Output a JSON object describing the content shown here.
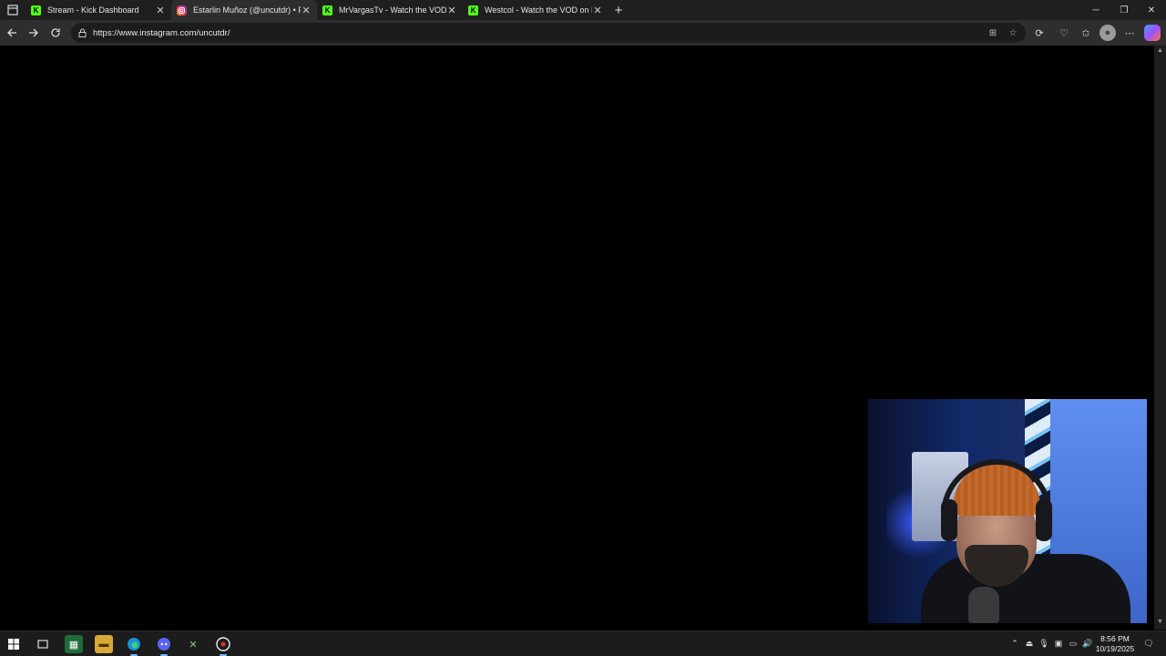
{
  "browser": {
    "tabs": [
      {
        "title": "Stream - Kick Dashboard",
        "favicon": "kick-icon",
        "active": false
      },
      {
        "title": "Estarlin Muñoz (@uncutdr) • Foto",
        "favicon": "instagram-icon",
        "active": true
      },
      {
        "title": "MrVargasTv - Watch the VOD on",
        "favicon": "kick-icon",
        "active": false
      },
      {
        "title": "Westcol - Watch the VOD on Kick",
        "favicon": "kick-icon",
        "active": false
      }
    ],
    "new_tab": "+",
    "address": "https://www.instagram.com/uncutdr/"
  },
  "taskbar": {
    "time": "8:56 PM",
    "date": "10/19/2025"
  },
  "colors": {
    "kick_green": "#53fc18",
    "page_background": "#000000",
    "chrome_dark": "#1f1f1f"
  }
}
